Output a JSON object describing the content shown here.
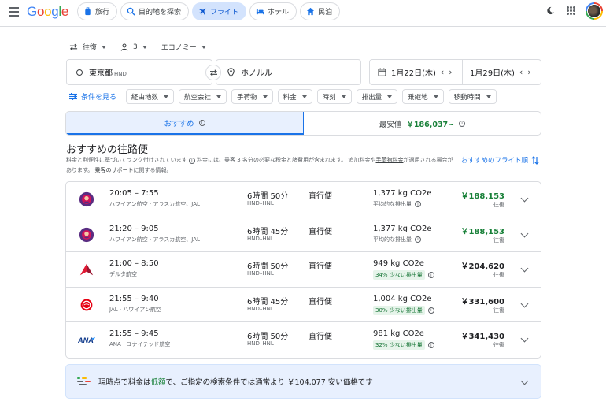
{
  "header": {
    "logo": "Google",
    "tabs": [
      {
        "label": "旅行",
        "icon": "suitcase-icon"
      },
      {
        "label": "目的地を探索",
        "icon": "explore-icon"
      },
      {
        "label": "フライト",
        "icon": "plane-icon"
      },
      {
        "label": "ホテル",
        "icon": "bed-icon"
      },
      {
        "label": "民泊",
        "icon": "house-icon"
      }
    ]
  },
  "search": {
    "trip_type": "往復",
    "passengers": "3",
    "cabin": "エコノミー",
    "origin": "東京都",
    "origin_code": "HND",
    "destination": "ホノルル",
    "depart_date": "1月22日(木)",
    "return_date": "1月29日(木)"
  },
  "filters": {
    "more_label": "条件を見る",
    "chips": [
      "経由地数",
      "航空会社",
      "手荷物",
      "料金",
      "時刻",
      "排出量",
      "乗継地",
      "移動時間"
    ]
  },
  "sort_tabs": {
    "best_label": "おすすめ",
    "cheapest_label": "最安値",
    "cheapest_price": "￥186,037~"
  },
  "section": {
    "title": "おすすめの往路便",
    "note_part1": "料金と利便性に基づいてランク付けされています",
    "note_part2": "料金には、乗客 3 名分の必要な税金と諸費用が含まれます。 追加料金や",
    "note_link1": "手荷物料金",
    "note_part3": "が適用される場合があります。",
    "note_link2": "乗客のサポート",
    "note_part4": "に関する情報。",
    "sort_link": "おすすめのフライト順"
  },
  "flights": [
    {
      "times": "20:05 – 7:55",
      "airline": "ハワイアン航空 · アラスカ航空、JAL",
      "duration": "6時間 50分",
      "route": "HND–HNL",
      "stops": "直行便",
      "co2": "1,377 kg CO2e",
      "co2_note": "平均的な排出量",
      "co2_badge": false,
      "price": "￥188,153",
      "price_green": true,
      "price_type": "往復",
      "logo": "hawaiian"
    },
    {
      "times": "21:20 – 9:05",
      "airline": "ハワイアン航空 · アラスカ航空、JAL",
      "duration": "6時間 45分",
      "route": "HND–HNL",
      "stops": "直行便",
      "co2": "1,377 kg CO2e",
      "co2_note": "平均的な排出量",
      "co2_badge": false,
      "price": "￥188,153",
      "price_green": true,
      "price_type": "往復",
      "logo": "hawaiian"
    },
    {
      "times": "21:00 – 8:50",
      "airline": "デルタ航空",
      "duration": "6時間 50分",
      "route": "HND–HNL",
      "stops": "直行便",
      "co2": "949 kg CO2e",
      "co2_note": "34% 少ない排出量",
      "co2_badge": true,
      "price": "￥204,620",
      "price_green": false,
      "price_type": "往復",
      "logo": "delta"
    },
    {
      "times": "21:55 – 9:40",
      "airline": "JAL · ハワイアン航空",
      "duration": "6時間 45分",
      "route": "HND–HNL",
      "stops": "直行便",
      "co2": "1,004 kg CO2e",
      "co2_note": "30% 少ない排出量",
      "co2_badge": true,
      "price": "￥331,600",
      "price_green": false,
      "price_type": "往復",
      "logo": "jal"
    },
    {
      "times": "21:55 – 9:45",
      "airline": "ANA · ユナイテッド航空",
      "duration": "6時間 50分",
      "route": "HND–HNL",
      "stops": "直行便",
      "co2": "981 kg CO2e",
      "co2_note": "32% 少ない排出量",
      "co2_badge": true,
      "price": "￥341,430",
      "price_green": false,
      "price_type": "往復",
      "logo": "ana"
    }
  ],
  "tip": {
    "part1": "現時点で料金は",
    "low": "低額",
    "part2": "で、ご指定の検索条件では通常より ￥104,077 安い価格です"
  },
  "colors": {
    "accent": "#1a73e8",
    "green": "#188038",
    "active_tab_bg": "#d3e3fd"
  }
}
